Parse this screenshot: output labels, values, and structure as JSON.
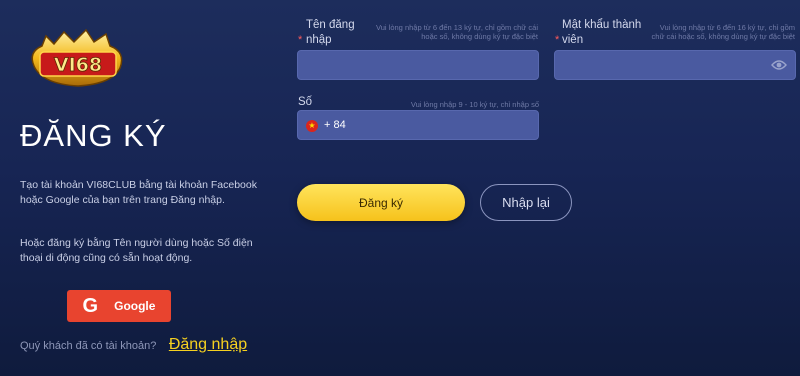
{
  "logo": {
    "text": "VI68"
  },
  "sidebar": {
    "title": "ĐĂNG KÝ",
    "description_1": "Tạo tài khoản VI68CLUB bằng tài khoản Facebook hoặc Google của bạn trên trang Đăng nhập.",
    "description_2": "Hoặc đăng ký bằng Tên người dùng hoặc Số điện thoại di động cũng có sẵn hoạt động.",
    "google_label": "Google",
    "login_question": "Quý khách đã có tài khoản?",
    "login_link": "Đăng nhập"
  },
  "form": {
    "username": {
      "required_mark": "*",
      "label": "Tên đăng nhập",
      "hint": "Vui lòng nhập từ 6 đến 13 ký tự, chỉ gồm chữ cái hoặc số, không dùng ký tự đặc biệt",
      "value": ""
    },
    "password": {
      "required_mark": "*",
      "label": "Mật khẩu thành viên",
      "hint": "Vui lòng nhập từ 6 đến 16 ký tự, chỉ gồm chữ cái hoặc số, không dùng ký tự đặc biệt",
      "value": ""
    },
    "phone": {
      "label": "Số điện thoại",
      "hint": "Vui lòng nhập 9 - 10 ký tự, chỉ nhập số",
      "prefix": "+ 84",
      "flag_icon": "vietnam-flag-icon",
      "value": ""
    },
    "register_label": "Đăng ký",
    "reset_label": "Nhập lại"
  },
  "colors": {
    "accent": "#f6c21b",
    "google": "#e8442f",
    "input_bg": "#4a5aa0",
    "link": "#f5d020"
  }
}
